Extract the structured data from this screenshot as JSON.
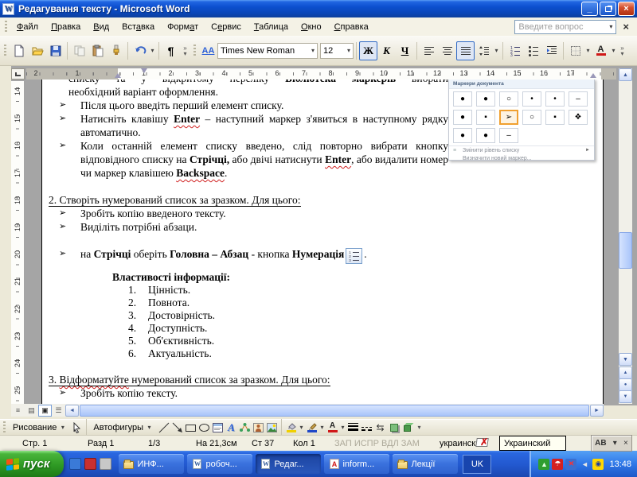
{
  "titlebar": {
    "title": "Редагування тексту - Microsoft Word",
    "app_letter": "W"
  },
  "window_controls": {
    "minimize": "_",
    "close": "×"
  },
  "menubar": {
    "items": [
      {
        "label": "Файл",
        "hot": 0
      },
      {
        "label": "Правка",
        "hot": 0
      },
      {
        "label": "Вид",
        "hot": 0
      },
      {
        "label": "Вставка",
        "hot": 3
      },
      {
        "label": "Формат",
        "hot": 4
      },
      {
        "label": "Сервис",
        "hot": 1
      },
      {
        "label": "Таблица",
        "hot": 0
      },
      {
        "label": "Окно",
        "hot": 0
      },
      {
        "label": "Справка",
        "hot": 0
      }
    ],
    "question_placeholder": "Введите вопрос",
    "close_glyph": "×"
  },
  "toolbar": {
    "font_name": "Times New Roman",
    "font_size": "12",
    "bold_label": "Ж",
    "italic_label": "К",
    "underline_label": "Ч",
    "styles_label": "АА",
    "font_color_letter": "А",
    "pilcrow": "¶",
    "overflow_chevron": "»",
    "dropdown_arrow": "▾"
  },
  "hruler": {
    "margin_numbers": [
      "2",
      "1"
    ],
    "numbers": [
      "1",
      "2",
      "3",
      "4",
      "5",
      "6",
      "7",
      "8",
      "9",
      "10",
      "11",
      "12",
      "13",
      "14",
      "15",
      "16",
      "17"
    ]
  },
  "vruler": {
    "numbers": [
      "14",
      "15",
      "16",
      "17",
      "18",
      "19",
      "20",
      "21",
      "22",
      "23",
      "24",
      "25"
    ]
  },
  "document": {
    "bullet_char": "➢",
    "blocks": [
      {
        "type": "cont",
        "jl": true,
        "runs": [
          {
            "t": "списку та у відкритому переліку "
          },
          {
            "t": "Бібліотека маркерів",
            "b": true
          },
          {
            "t": " вибрати"
          }
        ]
      },
      {
        "type": "cont",
        "runs": [
          {
            "t": "необхідний варіант оформлення."
          }
        ]
      },
      {
        "type": "bullet",
        "runs": [
          {
            "t": "Після цього введіть перший елемент списку."
          }
        ]
      },
      {
        "type": "bullet",
        "just": true,
        "runs": [
          {
            "t": "Натисніть клавішу "
          },
          {
            "t": "Enter",
            "b": true,
            "w": true
          },
          {
            "t": " – наступний маркер з'явиться в наступному рядку автоматично."
          }
        ]
      },
      {
        "type": "bullet",
        "just": true,
        "runs": [
          {
            "t": "Коли останній елемент списку введено, слід повторно вибрати кнопку відповідного списку на "
          },
          {
            "t": "Стрічці,",
            "b": true
          },
          {
            "t": " або двічі натиснути "
          },
          {
            "t": "Enter",
            "b": true,
            "w": true
          },
          {
            "t": ", або видалити номер чи маркер клавішею "
          },
          {
            "t": "Backspace",
            "b": true,
            "w": true
          },
          {
            "t": "."
          }
        ]
      },
      {
        "type": "heading",
        "gap": 17,
        "runs": [
          {
            "t": "2. Створіть нумерований список за зразком. Для цього:",
            "u": true
          }
        ]
      },
      {
        "type": "bullet",
        "runs": [
          {
            "t": "Зробіть копію введеного тексту."
          }
        ]
      },
      {
        "type": "bullet",
        "runs": [
          {
            "t": " Виділіть потрібні абзаци."
          }
        ]
      },
      {
        "type": "bullet",
        "gap": 17,
        "icon_after": "numbering-button-icon",
        "tail": ".",
        "runs": [
          {
            "t": "на "
          },
          {
            "t": "Стрічці",
            "b": true
          },
          {
            "t": " оберіть "
          },
          {
            "t": "Головна – Абзац",
            "b": true
          },
          {
            "t": " - кнопка "
          },
          {
            "t": "Нумерація",
            "b": true
          }
        ]
      },
      {
        "type": "sub",
        "gap": 8,
        "runs": [
          {
            "t": "Властивості інформації:",
            "b": true
          }
        ]
      },
      {
        "type": "num",
        "marker": "1.",
        "runs": [
          {
            "t": "Цінність."
          }
        ]
      },
      {
        "type": "num",
        "marker": "2.",
        "runs": [
          {
            "t": "Повнота."
          }
        ]
      },
      {
        "type": "num",
        "marker": "3.",
        "runs": [
          {
            "t": "Достовірність."
          }
        ]
      },
      {
        "type": "num",
        "marker": "4.",
        "runs": [
          {
            "t": "Доступність."
          }
        ]
      },
      {
        "type": "num",
        "marker": "5.",
        "runs": [
          {
            "t": "Об'єктивність."
          }
        ]
      },
      {
        "type": "num",
        "marker": "6.",
        "runs": [
          {
            "t": "Актуальність."
          }
        ]
      },
      {
        "type": "heading",
        "gap": 16,
        "runs": [
          {
            "t": "3. ",
            "u": true
          },
          {
            "t": "Відформатуйте",
            "u": true,
            "w": true
          },
          {
            "t": " нумерований список за зразком. Для цього:",
            "u": true
          }
        ]
      },
      {
        "type": "bullet",
        "runs": [
          {
            "t": "Зробіть копію тексту."
          }
        ]
      }
    ]
  },
  "bullet_panel": {
    "title": "Маркери документа",
    "cells": [
      "●",
      "●",
      "○",
      "•",
      "•",
      "–",
      "●",
      "▪",
      "➢",
      "○",
      "▪",
      "❖",
      "●",
      "●",
      "–"
    ],
    "selected_index": 8,
    "menu_items": [
      {
        "label": "Змінити рівень списку",
        "arrow": "►"
      },
      {
        "label": "Визначити новий маркер...",
        "arrow": ""
      }
    ]
  },
  "scrollbar": {
    "up": "▲",
    "down": "▼",
    "left": "◄",
    "right": "►",
    "prev": "▲",
    "browse": "●",
    "next": "▼"
  },
  "view_buttons": {
    "normal": "≡",
    "web": "▤",
    "print": "▣",
    "outline": "☰"
  },
  "drawing_toolbar": {
    "draw_label": "Рисование",
    "autoshapes_label": "Автофигуры",
    "font_color_letter": "А",
    "arrow_style_glyph": "⇆",
    "dropdown_arrow": "▾"
  },
  "statusbar": {
    "page": "Стр. 1",
    "section": "Разд 1",
    "page_of": "1/3",
    "at": "На 21,3см",
    "line": "Ст 37",
    "column": "Кол 1",
    "flags": [
      "ЗАП",
      "ИСПР",
      "ВДЛ",
      "ЗАМ"
    ],
    "language": "украинский",
    "lang_popup": "Украинский",
    "langbar_label": "АВ",
    "langbar_arrow": "▾",
    "langbar_close": "×"
  },
  "taskbar": {
    "start_label": "пуск",
    "tasks": [
      {
        "label": "ИНФ...",
        "icon": "folder",
        "active": false
      },
      {
        "label": "робоч...",
        "icon": "word",
        "active": false
      },
      {
        "label": "Редаг...",
        "icon": "word",
        "active": true
      },
      {
        "label": "inform...",
        "icon": "pdf",
        "active": false
      },
      {
        "label": "Лекції",
        "icon": "folder",
        "active": false
      }
    ],
    "language_indicator": "UK",
    "clock": "13:48",
    "tray_umbrella": "☂",
    "tray_net_x": "✕",
    "tray_dot": "◉",
    "tray_speaker": "◄"
  },
  "colors": {
    "accent_blue": "#316ac5",
    "taskbar_blue": "#2258cf",
    "start_green": "#2f9a24",
    "title_blue": "#0d50cf"
  }
}
